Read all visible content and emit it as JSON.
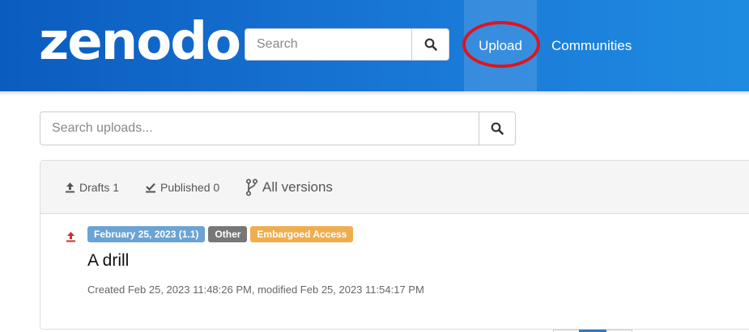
{
  "header": {
    "logo": "zenodo",
    "search_placeholder": "Search",
    "nav": {
      "upload": "Upload",
      "communities": "Communities"
    }
  },
  "uploads": {
    "search_placeholder": "Search uploads...",
    "filters": {
      "drafts": "Drafts 1",
      "published": "Published 0",
      "versions": "All versions"
    },
    "records": [
      {
        "badge_date": "February 25, 2023 (1.1)",
        "badge_type": "Other",
        "badge_access": "Embargoed Access",
        "title": "A drill",
        "meta": "Created Feb 25, 2023 11:48:26 PM, modified Feb 25, 2023 11:54:17 PM"
      }
    ]
  },
  "colors": {
    "header_blue": "#0b5cbf",
    "badge_date": "#6aa3d5",
    "badge_other": "#777777",
    "badge_embargoed": "#f0ad4e",
    "annotation_circle": "#e0141e"
  },
  "icons": [
    "search-icon",
    "upload-icon",
    "check-tray-icon",
    "branch-icon",
    "record-upload-icon"
  ]
}
